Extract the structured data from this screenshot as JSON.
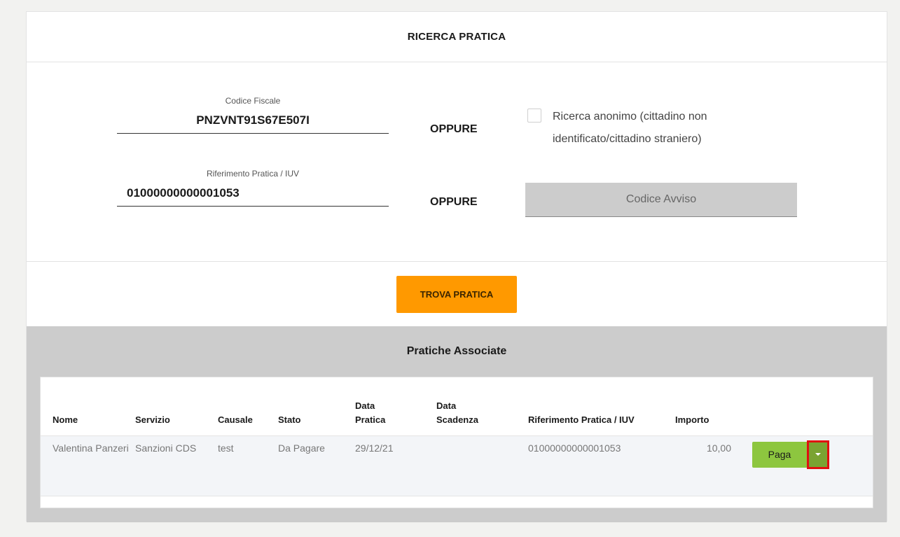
{
  "search": {
    "title": "RICERCA PRATICA",
    "codice_fiscale_label": "Codice Fiscale",
    "codice_fiscale_value": "PNZVNT91S67E507I",
    "riferimento_label": "Riferimento Pratica / IUV",
    "riferimento_value": "01000000000001053",
    "oppure_1": "OPPURE",
    "oppure_2": "OPPURE",
    "anonimo_label": "Ricerca anonimo (cittadino non identificato/cittadino straniero)",
    "codice_avviso_label": "Codice Avviso",
    "trova_label": "TROVA PRATICA"
  },
  "associate": {
    "title": "Pratiche Associate",
    "columns": {
      "nome": "Nome",
      "servizio": "Servizio",
      "causale": "Causale",
      "stato": "Stato",
      "data_pratica": "Data Pratica",
      "data_scadenza": "Data Scadenza",
      "riferimento": "Riferimento Pratica / IUV",
      "importo": "Importo"
    },
    "rows": [
      {
        "nome": "Valentina Panzeri",
        "servizio": "Sanzioni CDS",
        "causale": "test",
        "stato": "Da Pagare",
        "data_pratica": "29/12/21",
        "data_scadenza": "",
        "riferimento": "01000000000001053",
        "importo": "10,00",
        "action_label": "Paga",
        "dropdown_icon": "caret-down-icon"
      }
    ]
  },
  "colors": {
    "accent_orange": "#ff9900",
    "pay_green": "#8dc63f",
    "highlight_red": "#e01010",
    "panel_gray": "#cccccc"
  }
}
